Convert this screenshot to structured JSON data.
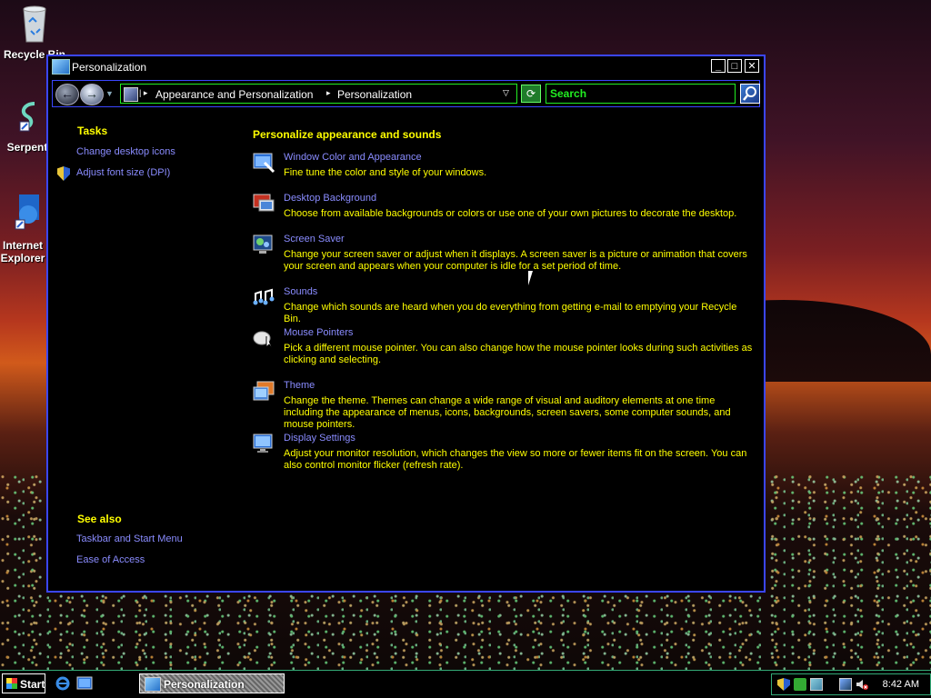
{
  "desktop": {
    "icons": [
      {
        "label": "Recycle Bin"
      },
      {
        "label": "Serpent"
      },
      {
        "label": "Internet Explorer"
      }
    ]
  },
  "window": {
    "title": "Personalization",
    "address": {
      "crumbs": [
        "Appearance and Personalization",
        "Personalization"
      ]
    },
    "search": {
      "placeholder": "Search"
    },
    "tasks": {
      "heading": "Tasks",
      "links": [
        "Change desktop icons",
        "Adjust font size (DPI)"
      ]
    },
    "see_also": {
      "heading": "See also",
      "links": [
        "Taskbar and Start Menu",
        "Ease of Access"
      ]
    },
    "main": {
      "heading": "Personalize appearance and sounds",
      "items": [
        {
          "title": "Window Color and Appearance",
          "desc": "Fine tune the color and style of your windows.",
          "icon": "window-color-icon"
        },
        {
          "title": "Desktop Background",
          "desc": "Choose from available backgrounds or colors or use one of your own pictures to decorate the desktop.",
          "icon": "desktop-background-icon"
        },
        {
          "title": "Screen Saver",
          "desc": "Change your screen saver or adjust when it displays. A screen saver is a picture or animation that covers your screen and appears when your computer is idle for a set period of time.",
          "icon": "screen-saver-icon"
        },
        {
          "title": "Sounds",
          "desc": "Change which sounds are heard when you do everything from getting e-mail to emptying your Recycle Bin.",
          "icon": "sounds-icon"
        },
        {
          "title": "Mouse Pointers",
          "desc": "Pick a different mouse pointer. You can also change how the mouse pointer looks during such activities as clicking and selecting.",
          "icon": "mouse-pointers-icon"
        },
        {
          "title": "Theme",
          "desc": "Change the theme. Themes can change a wide range of visual and auditory elements at one time including the appearance of menus, icons, backgrounds, screen savers, some computer sounds, and mouse pointers.",
          "icon": "theme-icon"
        },
        {
          "title": "Display Settings",
          "desc": "Adjust your monitor resolution, which changes the view so more or fewer items fit on the screen. You can also control monitor flicker (refresh rate).",
          "icon": "display-settings-icon"
        }
      ]
    }
  },
  "taskbar": {
    "start_label": "Start",
    "task_label": "Personalization",
    "clock": "8:42 AM"
  },
  "colors": {
    "accent_border": "#3b46ff",
    "heading_yellow": "#ffff00",
    "link": "#8a8cff",
    "search_green": "#22ee22"
  }
}
